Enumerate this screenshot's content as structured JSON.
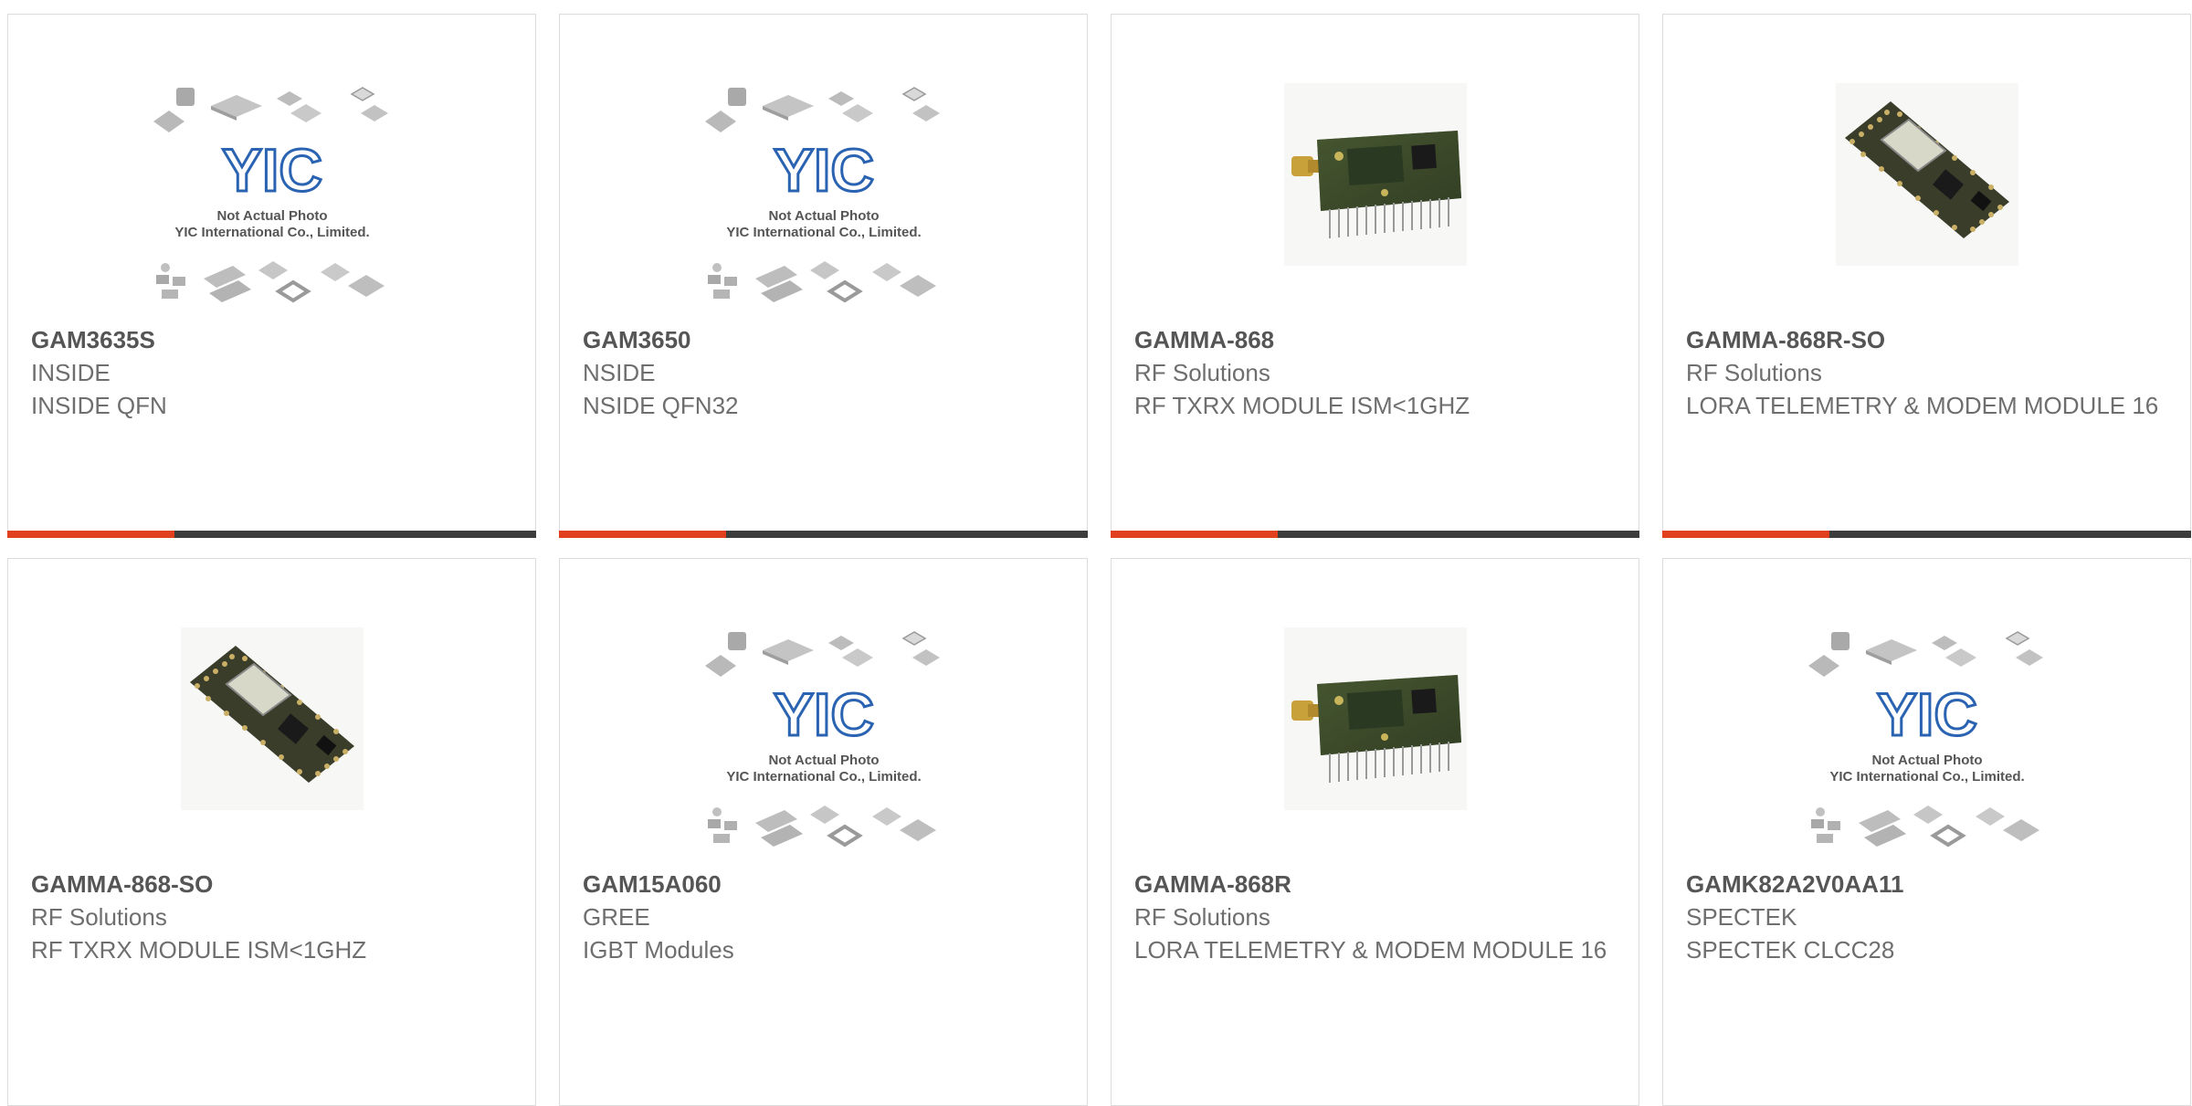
{
  "placeholder": {
    "line1": "Not Actual Photo",
    "line2": "YIC International Co., Limited.",
    "logo": "YIC"
  },
  "accent_color": "#e0401d",
  "bar_color": "#3c3c3c",
  "products": [
    {
      "part": "GAM3635S",
      "brand": "INSIDE",
      "desc": "INSIDE QFN",
      "image": "yic-placeholder"
    },
    {
      "part": "GAM3650",
      "brand": "NSIDE",
      "desc": "NSIDE QFN32",
      "image": "yic-placeholder"
    },
    {
      "part": "GAMMA-868",
      "brand": "RF Solutions",
      "desc": "RF TXRX MODULE ISM<1GHZ",
      "image": "rf-module-with-antenna"
    },
    {
      "part": "GAMMA-868R-SO",
      "brand": "RF Solutions",
      "desc": "LORA TELEMETRY & MODEM MODULE 16",
      "image": "lora-module-pcb"
    },
    {
      "part": "GAMMA-868-SO",
      "brand": "RF Solutions",
      "desc": "RF TXRX MODULE ISM<1GHZ",
      "image": "lora-module-pcb"
    },
    {
      "part": "GAM15A060",
      "brand": "GREE",
      "desc": "IGBT Modules",
      "image": "yic-placeholder"
    },
    {
      "part": "GAMMA-868R",
      "brand": "RF Solutions",
      "desc": "LORA TELEMETRY & MODEM MODULE 16",
      "image": "rf-module-with-antenna"
    },
    {
      "part": "GAMK82A2V0AA11",
      "brand": "SPECTEK",
      "desc": "SPECTEK CLCC28",
      "image": "yic-placeholder"
    }
  ]
}
